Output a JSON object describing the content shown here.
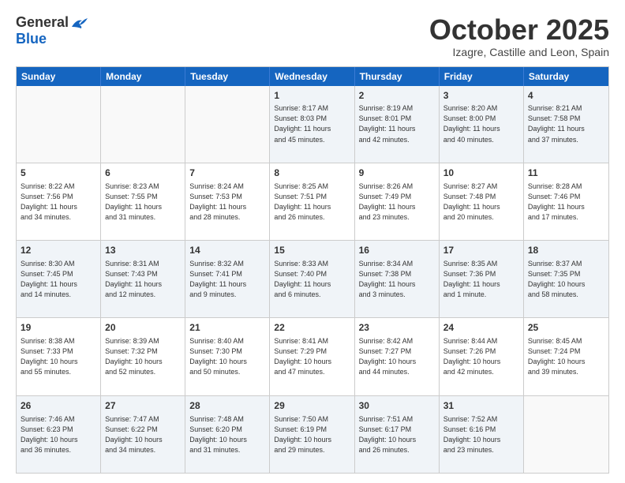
{
  "header": {
    "logo_general": "General",
    "logo_blue": "Blue",
    "month_title": "October 2025",
    "location": "Izagre, Castille and Leon, Spain"
  },
  "days_of_week": [
    "Sunday",
    "Monday",
    "Tuesday",
    "Wednesday",
    "Thursday",
    "Friday",
    "Saturday"
  ],
  "weeks": [
    [
      {
        "day": "",
        "empty": true
      },
      {
        "day": "",
        "empty": true
      },
      {
        "day": "",
        "empty": true
      },
      {
        "day": "1",
        "sunrise": "8:17 AM",
        "sunset": "8:03 PM",
        "daylight": "11 hours and 45 minutes."
      },
      {
        "day": "2",
        "sunrise": "8:19 AM",
        "sunset": "8:01 PM",
        "daylight": "11 hours and 42 minutes."
      },
      {
        "day": "3",
        "sunrise": "8:20 AM",
        "sunset": "8:00 PM",
        "daylight": "11 hours and 40 minutes."
      },
      {
        "day": "4",
        "sunrise": "8:21 AM",
        "sunset": "7:58 PM",
        "daylight": "11 hours and 37 minutes."
      }
    ],
    [
      {
        "day": "5",
        "sunrise": "8:22 AM",
        "sunset": "7:56 PM",
        "daylight": "11 hours and 34 minutes."
      },
      {
        "day": "6",
        "sunrise": "8:23 AM",
        "sunset": "7:55 PM",
        "daylight": "11 hours and 31 minutes."
      },
      {
        "day": "7",
        "sunrise": "8:24 AM",
        "sunset": "7:53 PM",
        "daylight": "11 hours and 28 minutes."
      },
      {
        "day": "8",
        "sunrise": "8:25 AM",
        "sunset": "7:51 PM",
        "daylight": "11 hours and 26 minutes."
      },
      {
        "day": "9",
        "sunrise": "8:26 AM",
        "sunset": "7:49 PM",
        "daylight": "11 hours and 23 minutes."
      },
      {
        "day": "10",
        "sunrise": "8:27 AM",
        "sunset": "7:48 PM",
        "daylight": "11 hours and 20 minutes."
      },
      {
        "day": "11",
        "sunrise": "8:28 AM",
        "sunset": "7:46 PM",
        "daylight": "11 hours and 17 minutes."
      }
    ],
    [
      {
        "day": "12",
        "sunrise": "8:30 AM",
        "sunset": "7:45 PM",
        "daylight": "11 hours and 14 minutes."
      },
      {
        "day": "13",
        "sunrise": "8:31 AM",
        "sunset": "7:43 PM",
        "daylight": "11 hours and 12 minutes."
      },
      {
        "day": "14",
        "sunrise": "8:32 AM",
        "sunset": "7:41 PM",
        "daylight": "11 hours and 9 minutes."
      },
      {
        "day": "15",
        "sunrise": "8:33 AM",
        "sunset": "7:40 PM",
        "daylight": "11 hours and 6 minutes."
      },
      {
        "day": "16",
        "sunrise": "8:34 AM",
        "sunset": "7:38 PM",
        "daylight": "11 hours and 3 minutes."
      },
      {
        "day": "17",
        "sunrise": "8:35 AM",
        "sunset": "7:36 PM",
        "daylight": "11 hours and 1 minute."
      },
      {
        "day": "18",
        "sunrise": "8:37 AM",
        "sunset": "7:35 PM",
        "daylight": "10 hours and 58 minutes."
      }
    ],
    [
      {
        "day": "19",
        "sunrise": "8:38 AM",
        "sunset": "7:33 PM",
        "daylight": "10 hours and 55 minutes."
      },
      {
        "day": "20",
        "sunrise": "8:39 AM",
        "sunset": "7:32 PM",
        "daylight": "10 hours and 52 minutes."
      },
      {
        "day": "21",
        "sunrise": "8:40 AM",
        "sunset": "7:30 PM",
        "daylight": "10 hours and 50 minutes."
      },
      {
        "day": "22",
        "sunrise": "8:41 AM",
        "sunset": "7:29 PM",
        "daylight": "10 hours and 47 minutes."
      },
      {
        "day": "23",
        "sunrise": "8:42 AM",
        "sunset": "7:27 PM",
        "daylight": "10 hours and 44 minutes."
      },
      {
        "day": "24",
        "sunrise": "8:44 AM",
        "sunset": "7:26 PM",
        "daylight": "10 hours and 42 minutes."
      },
      {
        "day": "25",
        "sunrise": "8:45 AM",
        "sunset": "7:24 PM",
        "daylight": "10 hours and 39 minutes."
      }
    ],
    [
      {
        "day": "26",
        "sunrise": "7:46 AM",
        "sunset": "6:23 PM",
        "daylight": "10 hours and 36 minutes."
      },
      {
        "day": "27",
        "sunrise": "7:47 AM",
        "sunset": "6:22 PM",
        "daylight": "10 hours and 34 minutes."
      },
      {
        "day": "28",
        "sunrise": "7:48 AM",
        "sunset": "6:20 PM",
        "daylight": "10 hours and 31 minutes."
      },
      {
        "day": "29",
        "sunrise": "7:50 AM",
        "sunset": "6:19 PM",
        "daylight": "10 hours and 29 minutes."
      },
      {
        "day": "30",
        "sunrise": "7:51 AM",
        "sunset": "6:17 PM",
        "daylight": "10 hours and 26 minutes."
      },
      {
        "day": "31",
        "sunrise": "7:52 AM",
        "sunset": "6:16 PM",
        "daylight": "10 hours and 23 minutes."
      },
      {
        "day": "",
        "empty": true
      }
    ]
  ],
  "shaded_weeks": [
    0,
    2,
    4
  ]
}
